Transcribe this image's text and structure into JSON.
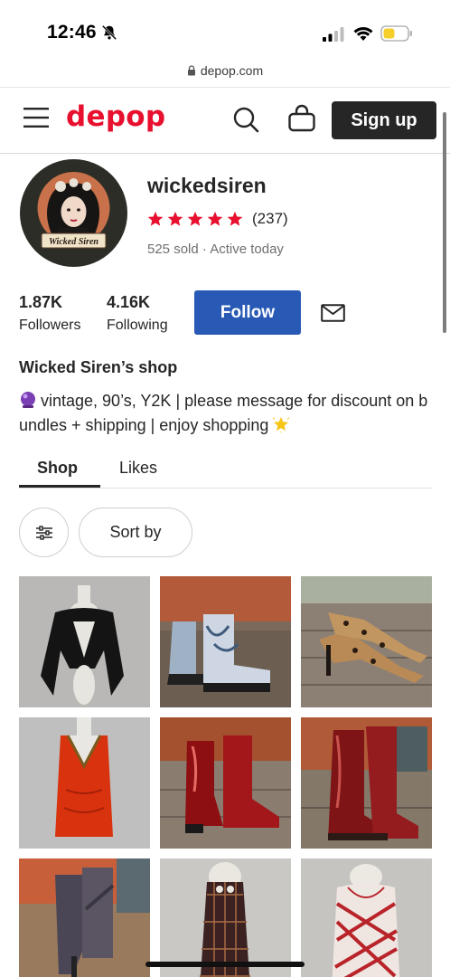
{
  "status_bar": {
    "time": "12:46",
    "icons": [
      "bell-slash-icon",
      "cellular-signal-icon",
      "wifi-icon",
      "battery-low-icon"
    ]
  },
  "browser": {
    "url": "depop.com",
    "lock_icon": "lock-icon"
  },
  "nav": {
    "logo": "depop",
    "signup_label": "Sign up",
    "brand_color": "#e8102e"
  },
  "profile": {
    "username": "wickedsiren",
    "avatar_caption": "Wicked Siren",
    "rating_stars": 5,
    "rating_count": "(237)",
    "activity": "525 sold · Active today",
    "followers_count": "1.87K",
    "followers_label": "Followers",
    "following_count": "4.16K",
    "following_label": "Following",
    "follow_label": "Follow",
    "shop_title": "Wicked Siren’s shop",
    "bio": "vintage, 90’s, Y2K | please message for discount on bundles + shipping | enjoy shopping"
  },
  "tabs": [
    {
      "label": "Shop",
      "active": true
    },
    {
      "label": "Likes",
      "active": false
    }
  ],
  "controls": {
    "sort_label": "Sort by"
  },
  "products": [
    {
      "icon": "black-bolero-top"
    },
    {
      "icon": "printed-lace-up-boots"
    },
    {
      "icon": "leopard-print-heels"
    },
    {
      "icon": "red-sheer-top"
    },
    {
      "icon": "red-patent-ankle-boots"
    },
    {
      "icon": "red-leather-knee-boots"
    },
    {
      "icon": "grey-leather-boots"
    },
    {
      "icon": "plaid-mini-dress"
    },
    {
      "icon": "red-plaid-dress"
    }
  ],
  "colors": {
    "follow_blue": "#2859b5",
    "star_red": "#e8102e"
  }
}
